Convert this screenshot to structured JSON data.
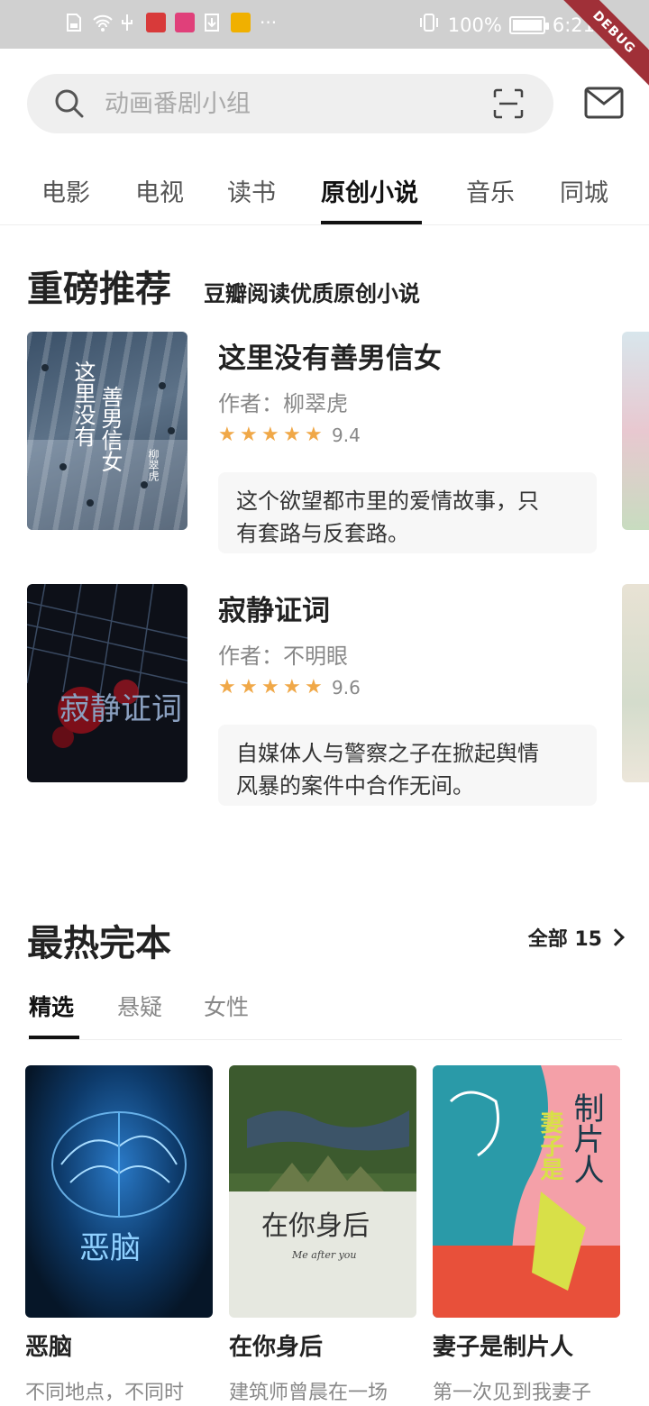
{
  "status_bar": {
    "battery": "100%",
    "time": "6:21",
    "debug": "DEBUG",
    "battery_level": 1.0
  },
  "search": {
    "placeholder": "动画番剧小组"
  },
  "tabs": [
    {
      "label": "电影"
    },
    {
      "label": "电视"
    },
    {
      "label": "读书"
    },
    {
      "label": "原创小说",
      "active": true
    },
    {
      "label": "音乐"
    },
    {
      "label": "同城"
    }
  ],
  "featured": {
    "title": "重磅推荐",
    "subtitle": "豆瓣阅读优质原创小说",
    "books": [
      {
        "title": "这里没有善男信女",
        "author": "作者：柳翠虎",
        "rating": 9.4,
        "stars": "★★★★★",
        "score": "9.4",
        "desc_line1": "这个欲望都市里的爱情故事，只",
        "desc_line2": "有套路与反套路。",
        "cover_text": "这里没有善男信女",
        "cover_author": "柳翠虎"
      },
      {
        "title": "寂静证词",
        "author": "作者：不明眼",
        "rating": 9.6,
        "stars": "★★★★★",
        "score": "9.6",
        "desc_line1": "自媒体人与警察之子在掀起舆情",
        "desc_line2": "风暴的案件中合作无间。",
        "cover_text": "寂静证词"
      }
    ]
  },
  "hot_complete": {
    "title": "最热完本",
    "all_label": "全部 15",
    "subtabs": [
      {
        "label": "精选",
        "active": true
      },
      {
        "label": "悬疑"
      },
      {
        "label": "女性"
      }
    ],
    "books": [
      {
        "title": "恶脑",
        "desc": "不同地点，不同时",
        "cover_text": "恶脑"
      },
      {
        "title": "在你身后",
        "desc": "建筑师曾晨在一场",
        "cover_text": "在你身后",
        "cover_sub": "Me after you"
      },
      {
        "title": "妻子是制片人",
        "desc": "第一次见到我妻子",
        "cover_text": "妻子是制片人"
      }
    ]
  },
  "colors": {
    "star": "#f0a848",
    "debug_banner": "#a03038",
    "search_bg": "#efefef"
  }
}
